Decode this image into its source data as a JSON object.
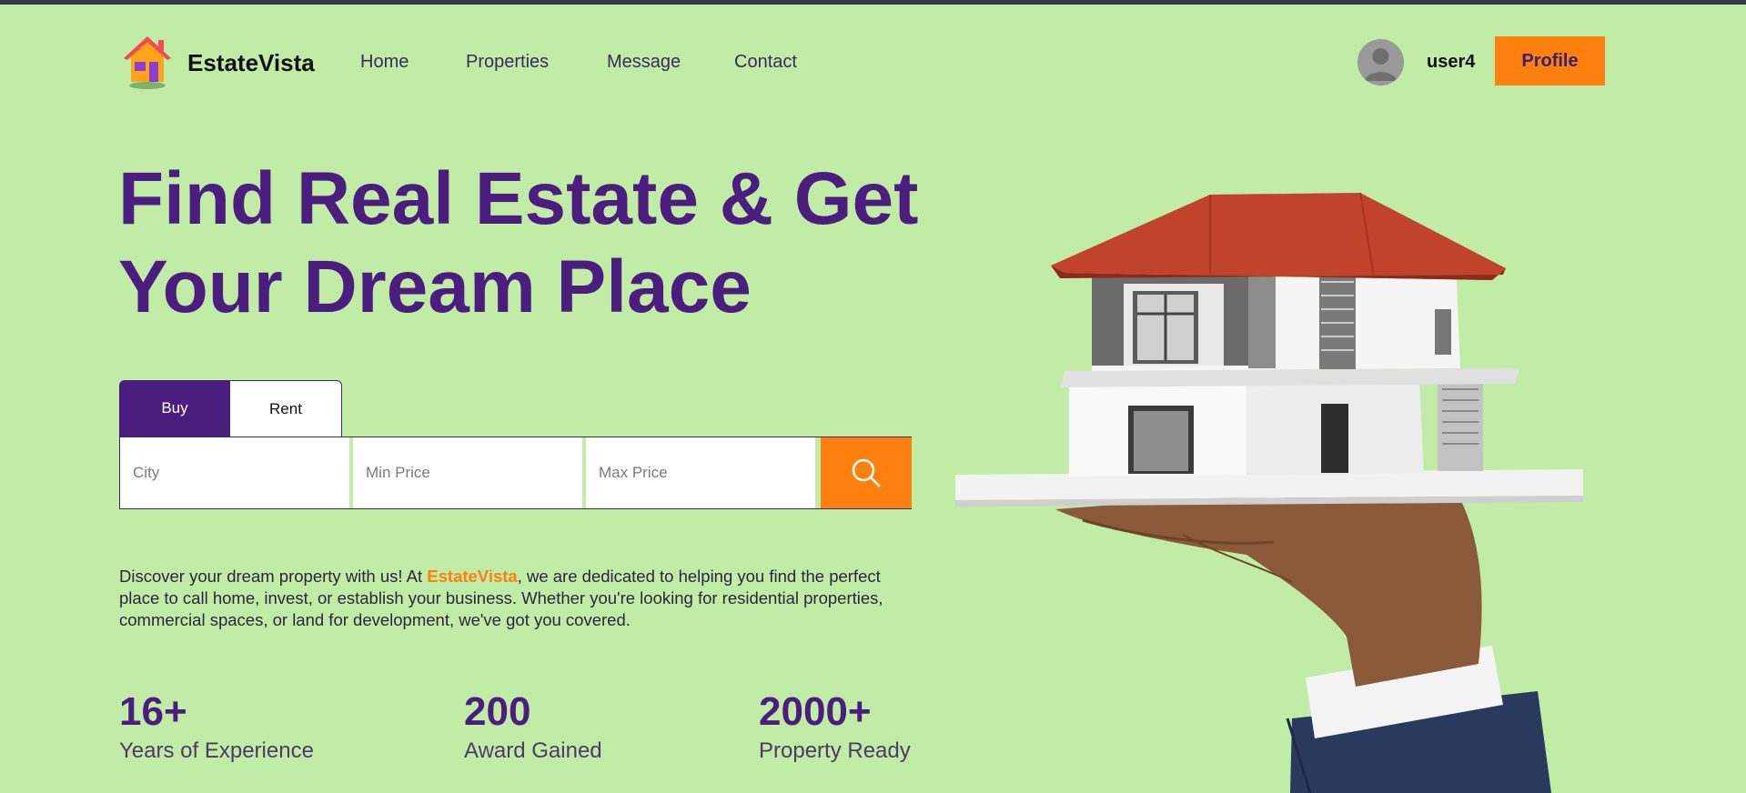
{
  "brand": {
    "name": "EstateVista"
  },
  "nav": {
    "links": [
      "Home",
      "Properties",
      "Message",
      "Contact"
    ],
    "username": "user4",
    "profile_label": "Profile"
  },
  "hero": {
    "title_line1": "Find Real Estate & Get",
    "title_line2": "Your Dream Place"
  },
  "search": {
    "tabs": [
      "Buy",
      "Rent"
    ],
    "active_tab": "Buy",
    "city_placeholder": "City",
    "min_price_placeholder": "Min Price",
    "max_price_placeholder": "Max Price",
    "button_icon": "search-icon"
  },
  "description": {
    "before": "Discover your dream property with us! At ",
    "highlight": "EstateVista",
    "after": ", we are dedicated to helping you find the perfect place to call home, invest, or establish your business. Whether you're looking for residential properties, commercial spaces, or land for development, we've got you covered."
  },
  "stats": [
    {
      "value": "16+",
      "label": "Years of Experience"
    },
    {
      "value": "200",
      "label": "Award Gained"
    },
    {
      "value": "2000+",
      "label": "Property Ready"
    }
  ],
  "colors": {
    "background": "#c1eca5",
    "primary": "#4b1d7f",
    "accent": "#ff7f0f"
  }
}
